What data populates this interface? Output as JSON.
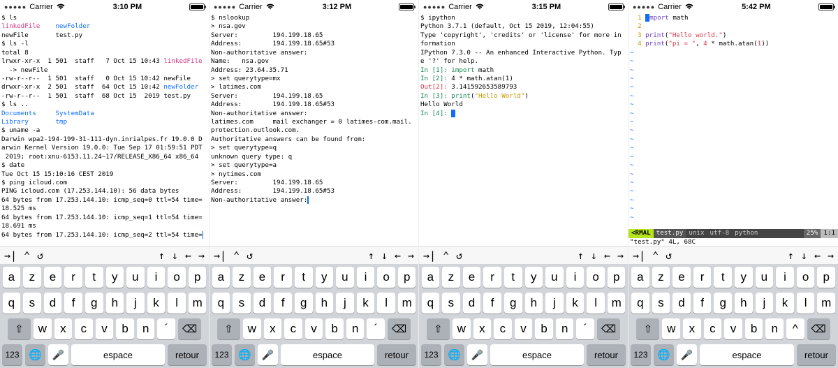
{
  "screens": [
    {
      "status": {
        "carrier": "Carrier",
        "time": "3:10 PM"
      },
      "term": {
        "lines": [
          {
            "segs": [
              {
                "t": "$ ls"
              }
            ]
          },
          {
            "segs": [
              {
                "t": "linkedFile",
                "c": "c-magenta"
              },
              {
                "t": "    "
              },
              {
                "t": "newFolder",
                "c": "c-blue"
              }
            ]
          },
          {
            "segs": [
              {
                "t": "newFile       test.py"
              }
            ]
          },
          {
            "segs": [
              {
                "t": "$ ls -l"
              }
            ]
          },
          {
            "segs": [
              {
                "t": "total 8"
              }
            ]
          },
          {
            "segs": [
              {
                "t": "lrwxr-xr-x  1 501  staff   7 Oct 15 10:43 "
              },
              {
                "t": "linkedFile",
                "c": "c-magenta"
              }
            ]
          },
          {
            "segs": [
              {
                "t": "  -> newFile"
              }
            ]
          },
          {
            "segs": [
              {
                "t": "-rw-r--r--  1 501  staff   0 Oct 15 10:42 newFile"
              }
            ]
          },
          {
            "segs": [
              {
                "t": "drwxr-xr-x  2 501  staff  64 Oct 15 10:42 "
              },
              {
                "t": "newFolder",
                "c": "c-blue"
              }
            ]
          },
          {
            "segs": [
              {
                "t": "-rw-r--r--  1 501  staff  68 Oct 15  2019 test.py"
              }
            ]
          },
          {
            "segs": [
              {
                "t": "$ ls .."
              }
            ]
          },
          {
            "segs": [
              {
                "t": "Documents",
                "c": "c-blue"
              },
              {
                "t": "     "
              },
              {
                "t": "SystemData",
                "c": "c-blue"
              }
            ]
          },
          {
            "segs": [
              {
                "t": "Library",
                "c": "c-blue"
              },
              {
                "t": "       "
              },
              {
                "t": "tmp",
                "c": "c-blue"
              }
            ]
          },
          {
            "segs": [
              {
                "t": "$ uname -a"
              }
            ]
          },
          {
            "segs": [
              {
                "t": "Darwin wpa2-194-199-31-111-dyn.inrialpes.fr 19.0.0 D"
              }
            ]
          },
          {
            "segs": [
              {
                "t": "arwin Kernel Version 19.0.0: Tue Sep 17 01:59:51 PDT"
              }
            ]
          },
          {
            "segs": [
              {
                "t": " 2019; root:xnu-6153.11.24~17/RELEASE_X86_64 x86_64"
              }
            ]
          },
          {
            "segs": [
              {
                "t": "$ date"
              }
            ]
          },
          {
            "segs": [
              {
                "t": "Tue Oct 15 15:10:16 CEST 2019"
              }
            ]
          },
          {
            "segs": [
              {
                "t": "$ ping icloud.com"
              }
            ]
          },
          {
            "segs": [
              {
                "t": "PING icloud.com (17.253.144.10): 56 data bytes"
              }
            ]
          },
          {
            "segs": [
              {
                "t": "64 bytes from 17.253.144.10: icmp_seq=0 ttl=54 time="
              }
            ]
          },
          {
            "segs": [
              {
                "t": "18.525 ms"
              }
            ]
          },
          {
            "segs": [
              {
                "t": "64 bytes from 17.253.144.10: icmp_seq=1 ttl=54 time="
              }
            ]
          },
          {
            "segs": [
              {
                "t": "18.691 ms"
              }
            ]
          },
          {
            "segs": [
              {
                "t": "64 bytes from 17.253.144.10: icmp_seq=2 ttl=54 time="
              },
              {
                "cursor": "thin"
              }
            ]
          }
        ]
      }
    },
    {
      "status": {
        "carrier": "Carrier",
        "time": "3:12 PM"
      },
      "term": {
        "lines": [
          {
            "segs": [
              {
                "t": "$ nslookup"
              }
            ]
          },
          {
            "segs": [
              {
                "t": "> nsa.gov"
              }
            ]
          },
          {
            "segs": [
              {
                "t": "Server:         194.199.18.65"
              }
            ]
          },
          {
            "segs": [
              {
                "t": "Address:        194.199.18.65#53"
              }
            ]
          },
          {
            "segs": [
              {
                "t": ""
              }
            ]
          },
          {
            "segs": [
              {
                "t": "Non-authoritative answer:"
              }
            ]
          },
          {
            "segs": [
              {
                "t": "Name:   nsa.gov"
              }
            ]
          },
          {
            "segs": [
              {
                "t": "Address: 23.64.35.71"
              }
            ]
          },
          {
            "segs": [
              {
                "t": "> set querytype=mx"
              }
            ]
          },
          {
            "segs": [
              {
                "t": "> latimes.com"
              }
            ]
          },
          {
            "segs": [
              {
                "t": "Server:         194.199.18.65"
              }
            ]
          },
          {
            "segs": [
              {
                "t": "Address:        194.199.18.65#53"
              }
            ]
          },
          {
            "segs": [
              {
                "t": ""
              }
            ]
          },
          {
            "segs": [
              {
                "t": "Non-authoritative answer:"
              }
            ]
          },
          {
            "segs": [
              {
                "t": "latimes.com     mail exchanger = 0 latimes-com.mail."
              }
            ]
          },
          {
            "segs": [
              {
                "t": "protection.outlook.com."
              }
            ]
          },
          {
            "segs": [
              {
                "t": ""
              }
            ]
          },
          {
            "segs": [
              {
                "t": "Authoritative answers can be found from:"
              }
            ]
          },
          {
            "segs": [
              {
                "t": "> set querytype=q"
              }
            ]
          },
          {
            "segs": [
              {
                "t": "unknown query type: q"
              }
            ]
          },
          {
            "segs": [
              {
                "t": "> set querytype=a"
              }
            ]
          },
          {
            "segs": [
              {
                "t": "> nytimes.com"
              }
            ]
          },
          {
            "segs": [
              {
                "t": "Server:         194.199.18.65"
              }
            ]
          },
          {
            "segs": [
              {
                "t": "Address:        194.199.18.65#53"
              }
            ]
          },
          {
            "segs": [
              {
                "t": ""
              }
            ]
          },
          {
            "segs": [
              {
                "t": "Non-authoritative answer:"
              },
              {
                "cursor": "thin"
              }
            ]
          }
        ]
      }
    },
    {
      "status": {
        "carrier": "Carrier",
        "time": "3:15 PM"
      },
      "term": {
        "lines": [
          {
            "segs": [
              {
                "t": "$ ipython"
              }
            ]
          },
          {
            "segs": [
              {
                "t": "Python 3.7.1 (default, Oct 15 2019, 12:04:55)"
              }
            ]
          },
          {
            "segs": [
              {
                "t": "Type 'copyright', 'credits' or 'license' for more in"
              }
            ]
          },
          {
            "segs": [
              {
                "t": "formation"
              }
            ]
          },
          {
            "segs": [
              {
                "t": "IPython 7.3.0 -- An enhanced Interactive Python. Typ"
              }
            ]
          },
          {
            "segs": [
              {
                "t": "e '?' for help."
              }
            ]
          },
          {
            "segs": [
              {
                "t": ""
              }
            ]
          },
          {
            "segs": [
              {
                "t": "In [",
                "c": "c-green"
              },
              {
                "t": "1",
                "c": "c-green"
              },
              {
                "t": "]: ",
                "c": "c-green"
              },
              {
                "t": "import",
                "c": "c-green"
              },
              {
                "t": " math"
              }
            ]
          },
          {
            "segs": [
              {
                "t": ""
              }
            ]
          },
          {
            "segs": [
              {
                "t": "In [",
                "c": "c-green"
              },
              {
                "t": "2",
                "c": "c-green"
              },
              {
                "t": "]: ",
                "c": "c-green"
              },
              {
                "t": "4"
              },
              {
                "t": " * math.atan("
              },
              {
                "t": "1"
              },
              {
                "t": ")"
              }
            ]
          },
          {
            "segs": [
              {
                "t": "Out[",
                "c": "c-red"
              },
              {
                "t": "2",
                "c": "c-red"
              },
              {
                "t": "]: ",
                "c": "c-red"
              },
              {
                "t": "3.141592653589793"
              }
            ]
          },
          {
            "segs": [
              {
                "t": ""
              }
            ]
          },
          {
            "segs": [
              {
                "t": "In [",
                "c": "c-green"
              },
              {
                "t": "3",
                "c": "c-green"
              },
              {
                "t": "]: ",
                "c": "c-green"
              },
              {
                "t": "print",
                "c": "c-green"
              },
              {
                "t": "("
              },
              {
                "t": "\"Hello World\"",
                "c": "c-yellow"
              },
              {
                "t": ")"
              }
            ]
          },
          {
            "segs": [
              {
                "t": "Hello World"
              }
            ]
          },
          {
            "segs": [
              {
                "t": ""
              }
            ]
          },
          {
            "segs": [
              {
                "t": "In [",
                "c": "c-green"
              },
              {
                "t": "4",
                "c": "c-green"
              },
              {
                "t": "]: ",
                "c": "c-green"
              },
              {
                "cursor": "block"
              }
            ]
          }
        ]
      }
    },
    {
      "status": {
        "carrier": "Carrier",
        "time": "5:42 PM"
      },
      "term": {
        "vim": true,
        "lines": [
          {
            "gut": "1",
            "segs": [
              {
                "cursor": "block"
              },
              {
                "t": "mport",
                "c": "c-purple"
              },
              {
                "t": " math"
              }
            ]
          },
          {
            "gut": "2",
            "segs": [
              {
                "t": ""
              }
            ]
          },
          {
            "gut": "3",
            "segs": [
              {
                "t": "print",
                "c": "c-purple"
              },
              {
                "t": "("
              },
              {
                "t": "\"Hello world.\"",
                "c": "c-red"
              },
              {
                "t": ")"
              }
            ]
          },
          {
            "gut": "4",
            "segs": [
              {
                "t": "print",
                "c": "c-purple"
              },
              {
                "t": "("
              },
              {
                "t": "\"pi = \"",
                "c": "c-red"
              },
              {
                "t": ", "
              },
              {
                "t": "4",
                "c": "c-red"
              },
              {
                "t": " * math.atan("
              },
              {
                "t": "1",
                "c": "c-red"
              },
              {
                "t": "))"
              }
            ]
          }
        ],
        "tildes": 20,
        "status_mode": "<RMAL",
        "status_file": "test.py",
        "status_os": "unix",
        "status_enc": "utf-8",
        "status_ft": "python",
        "status_pct": "25%",
        "status_pos": "1:1",
        "bottom": "\"test.py\" 4L, 68C"
      }
    }
  ],
  "accessory": {
    "left": [
      "→|",
      "⌃",
      "↺"
    ],
    "right": [
      "↑",
      "↓",
      "←",
      "→"
    ]
  },
  "keyboard": {
    "row1": [
      "a",
      "z",
      "e",
      "r",
      "t",
      "y",
      "u",
      "i",
      "o",
      "p"
    ],
    "row2": [
      "q",
      "s",
      "d",
      "f",
      "g",
      "h",
      "j",
      "k",
      "l",
      "m"
    ],
    "row3_mid": [
      "w",
      "x",
      "c",
      "v",
      "b",
      "n",
      "´"
    ],
    "row3_mid_caret": [
      "w",
      "x",
      "c",
      "v",
      "b",
      "n",
      "^"
    ],
    "shift": "⇧",
    "bksp": "⌫",
    "globe": "🌐",
    "mic": "🎤",
    "num": "123",
    "space": "espace",
    "return": "retour"
  }
}
